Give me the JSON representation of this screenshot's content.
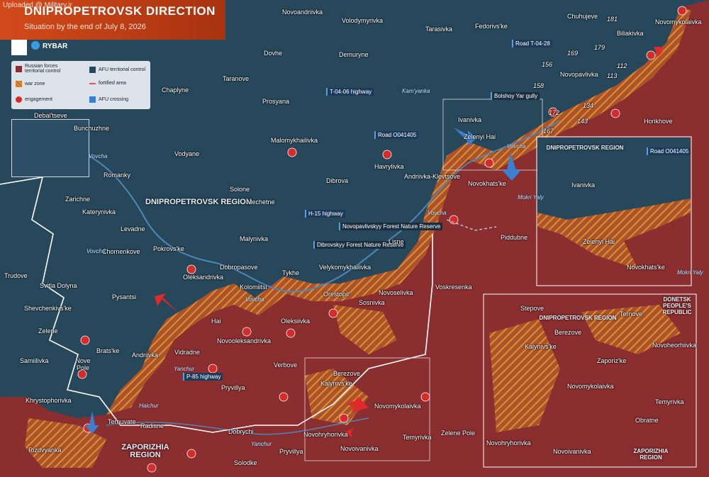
{
  "watermark": "Uploaded @ Military.ir",
  "header": {
    "title": "DNIPROPETROVSK DIRECTION",
    "subtitle": "Situation by the end of July 8, 2026"
  },
  "brand": "RYBAR",
  "legend": {
    "russian": "Russian forces territorial control",
    "afu": "AFU territorial control",
    "warzone": "war zone",
    "fortified": "fortified area",
    "engagement": "engagement",
    "crossing": "AFU crossing"
  },
  "colors": {
    "russian": "#8a2e30",
    "afu": "#27475b",
    "warzone": "#e0902a",
    "engagement": "#d52b2b",
    "crossing": "#3a7fd0"
  },
  "regions": {
    "dnipro": "DNIPROPETROVSK REGION",
    "zapo": "ZAPORIZHIA REGION",
    "donetsk": "DONETSK PEOPLE'S REPUBLIC"
  },
  "roads": {
    "t0428": "Road T-04-28",
    "t0406": "T-04-06 highway",
    "o041405": "Road O041405",
    "h15": "H-15 highway",
    "p85": "P-85 highway"
  },
  "features": {
    "bolshoy": "Bolshoy Yar gully",
    "nova_forest": "Novopavlivskyy Forest Nature Reserve",
    "dibrova_forest": "Dibrovskyy Forest Nature Reserve",
    "kamyanka": "Kam'yanka",
    "vovcha": "Vovcha",
    "yanchur": "Yanchur",
    "haichur": "Haichur",
    "mokri": "Mokri Yaly"
  },
  "heights": [
    "181",
    "179",
    "169",
    "156",
    "112",
    "113",
    "158",
    "172",
    "134",
    "143",
    "167"
  ],
  "towns": {
    "novoandriivka": "Novoandriivka",
    "volodymyrivka": "Volodymyrivka",
    "tarasivka": "Tarasivka",
    "fedorivske": "Fedorivs'ke",
    "chuhujeve": "Chuhujeve",
    "biliakivka": "Biliakivka",
    "novomykolaivka_ne": "Novomykolaivka",
    "dovhe": "Dovhe",
    "demuryne": "Demuryne",
    "taranove": "Taranove",
    "novopavlivka": "Novopavlivka",
    "chaplyne": "Chaplyne",
    "prosyana": "Prosyana",
    "debaltseve": "Debal'tseve",
    "bunchuzhne": "Bunchuzhne",
    "horikhove": "Horikhove",
    "ivanivka": "Ivanivka",
    "malomykhailivka": "Malomykhailivka",
    "zelenyi_hai": "Zelenyi Hai",
    "vodyane": "Vodyane",
    "havrylivka": "Havrylivka",
    "romanky": "Romanky",
    "andriivka_klevtsove": "Andriivka-Klevtsove",
    "novokhatske": "Novokhats'ke",
    "dibrova": "Dibrova",
    "solone": "Solone",
    "zarichne": "Zarichne",
    "mechetne": "Mechetne",
    "katerynivka": "Katerynivka",
    "levadne": "Levadne",
    "piddubne": "Piddubne",
    "malynivka": "Malynivka",
    "lisne": "Lisne",
    "pokrovske": "Pokrovs'ke",
    "chornenkove": "Chornenkove",
    "dobropasove": "Dobropasove",
    "oleksandrivka": "Oleksandrivka",
    "tykhe": "Tykhe",
    "velykomykhailivka": "Velykomykhailivka",
    "trudove": "Trudove",
    "svitla_dolyna": "Svitla Dolyna",
    "kolomiitsi": "Kolomiitsi",
    "voskresenka": "Voskresenka",
    "novoselivka": "Novoselivka",
    "orestopil": "Orestopil'",
    "pysantsi": "Pysantsi",
    "sosnivka": "Sosnivka",
    "shevchenkivske": "Shevchenkivs'ke",
    "hai": "Hai",
    "oleksiivka": "Oleksiivka",
    "zelene": "Zelene",
    "novooleksandrivka": "Novooleksandrivka",
    "bratske": "Brats'ke",
    "samiilivka": "Samiilivka",
    "andriivka": "Andriivka",
    "vidradne": "Vidradne",
    "nove_pole": "Nove Pole",
    "verbove": "Verbove",
    "berezove": "Berezove",
    "kalynivske": "Kalynivs'ke",
    "khrystophorivka": "Khrystophorivka",
    "pryvillya": "Pryvillya",
    "novomykolaivka": "Novomykolaivka",
    "ternuvate": "Ternuvate",
    "radisne": "Radisne",
    "novohryhorivka": "Novohryhorivka",
    "zelene_pole": "Zelene Pole",
    "dobrychi": "Dobrychi",
    "temyrivka": "Temyrivka",
    "novoivanivka": "Novoivanivka",
    "rizdvyanka": "Rizdvyanka",
    "pryvillya2": "Pryvillya",
    "solodke": "Solodke",
    "stepove": "Stepove",
    "ternove": "Ternove",
    "novoheorhiivka": "Novoheorhiivka",
    "zaporizke": "Zaporiz'ke",
    "obratne": "Obratne"
  }
}
